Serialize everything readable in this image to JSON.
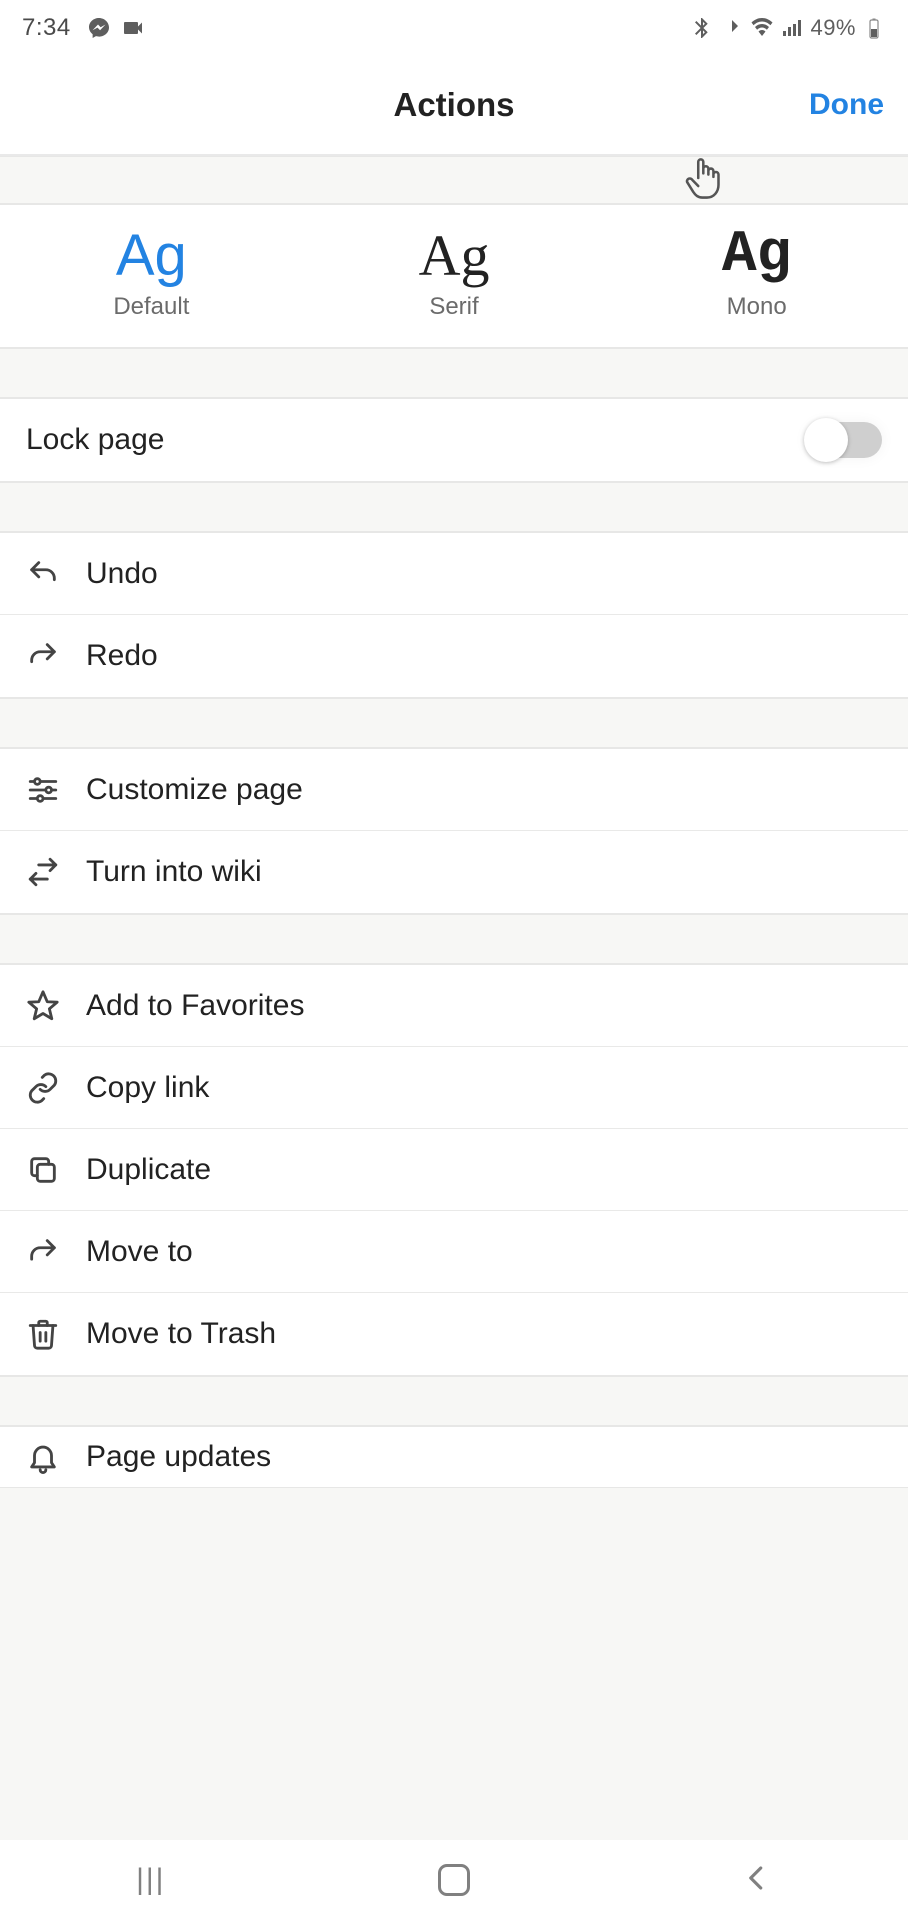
{
  "status": {
    "time": "7:34",
    "battery_text": "49%"
  },
  "header": {
    "title": "Actions",
    "done": "Done"
  },
  "fonts": {
    "default_sample": "Ag",
    "default_label": "Default",
    "serif_sample": "Ag",
    "serif_label": "Serif",
    "mono_sample": "Ag",
    "mono_label": "Mono"
  },
  "lock": {
    "label": "Lock page",
    "on": false
  },
  "actions": {
    "undo": "Undo",
    "redo": "Redo",
    "customize": "Customize page",
    "turn_wiki": "Turn into wiki",
    "favorites": "Add to Favorites",
    "copy_link": "Copy link",
    "duplicate": "Duplicate",
    "move_to": "Move to",
    "trash": "Move to Trash",
    "page_updates": "Page updates"
  }
}
